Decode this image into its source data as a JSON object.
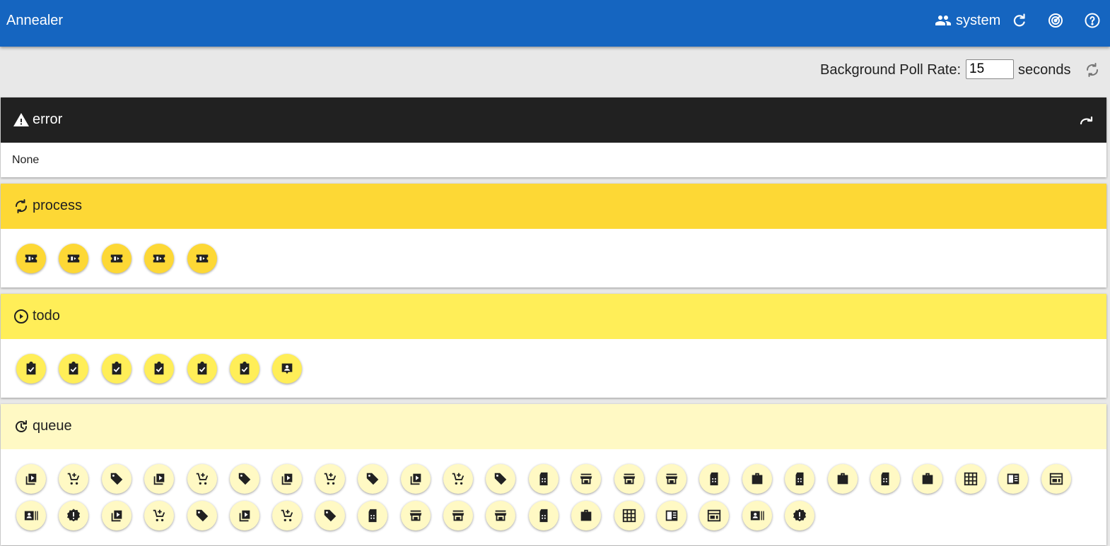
{
  "app": {
    "title": "Annealer"
  },
  "toolbar": {
    "user": "system",
    "icons": [
      "people-icon",
      "refresh-icon",
      "radar-icon",
      "help-icon"
    ]
  },
  "poll": {
    "label": "Background Poll Rate:",
    "value": "15",
    "unit": "seconds"
  },
  "colors": {
    "appbar": "#1565c0",
    "error_header": "#212121",
    "process_header": "#fdd835",
    "todo_header": "#ffee58",
    "queue_header": "#fff9c4"
  },
  "sections": {
    "error": {
      "title": "error",
      "icon": "warning-icon",
      "body": "None"
    },
    "process": {
      "title": "process",
      "icon": "sync-icon",
      "items": [
        "ticket-icon",
        "ticket-icon",
        "ticket-icon",
        "ticket-icon",
        "ticket-icon"
      ]
    },
    "todo": {
      "title": "todo",
      "icon": "play-circle-icon",
      "items": [
        "assignment-check-icon",
        "assignment-check-icon",
        "assignment-check-icon",
        "assignment-check-icon",
        "assignment-check-icon",
        "assignment-check-icon",
        "contact-id-icon"
      ]
    },
    "queue": {
      "title": "queue",
      "icon": "history-icon",
      "items": [
        "video-library-icon",
        "cart-add-icon",
        "tag-icon",
        "video-library-icon",
        "cart-add-icon",
        "tag-icon",
        "video-library-icon",
        "cart-add-icon",
        "tag-icon",
        "video-library-icon",
        "cart-add-icon",
        "tag-icon",
        "sim-card-icon",
        "store-icon",
        "store-icon",
        "store-icon",
        "sim-card-icon",
        "briefcase-icon",
        "sim-card-icon",
        "briefcase-icon",
        "sim-card-icon",
        "briefcase-icon",
        "grid-icon",
        "newspaper-icon",
        "web-card-icon",
        "badge-icon",
        "alert-badge-icon",
        "video-library-icon",
        "cart-add-icon",
        "tag-icon",
        "video-library-icon",
        "cart-add-icon",
        "tag-icon",
        "sim-card-icon",
        "store-icon",
        "store-icon",
        "store-icon",
        "sim-card-icon",
        "briefcase-icon",
        "grid-icon",
        "newspaper-icon",
        "web-card-icon",
        "badge-icon",
        "alert-badge-icon"
      ]
    }
  }
}
